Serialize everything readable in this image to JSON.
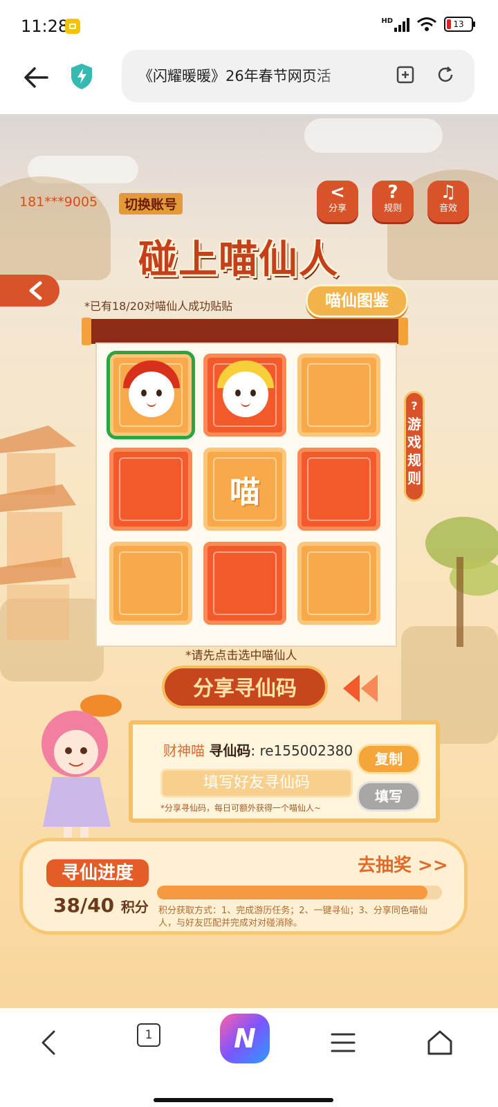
{
  "status_bar": {
    "time": "11:28",
    "network": "HD",
    "battery": "13"
  },
  "browser": {
    "url_title": "《闪耀暖暖》26年春节网页活"
  },
  "header": {
    "phone": "181***9005",
    "switch_account": "切换账号",
    "buttons": [
      {
        "label": "分享",
        "glyph": "<"
      },
      {
        "label": "规则",
        "glyph": "?"
      },
      {
        "label": "音效",
        "glyph": "♫"
      }
    ]
  },
  "game": {
    "title": "碰上喵仙人",
    "paired_note": "*已有18/20对喵仙人成功贴贴",
    "atlas_button": "喵仙图鉴",
    "center_tile": "喵",
    "rules_tab": "游戏规则",
    "rules_icon": "?",
    "select_hint": "*请先点击选中喵仙人",
    "share_code_button": "分享寻仙码"
  },
  "code_panel": {
    "cat_name": "财神喵",
    "code_label": "寻仙码",
    "code_value": "re155002380",
    "input_placeholder": "填写好友寻仙码",
    "copy_button": "复制",
    "fill_button": "填写",
    "tip": "*分享寻仙码，每日可额外获得一个喵仙人~"
  },
  "progress": {
    "label": "寻仙进度",
    "current": "38",
    "separator": "/",
    "total": "40",
    "unit": "积分",
    "fraction": 0.95,
    "draw_link": "去抽奖 >>",
    "method_text": "积分获取方式：1、完成游历任务；2、一键寻仙；3、分享同色喵仙人，与好友匹配并完成对对碰消除。"
  },
  "bottom_nav": {
    "tab_count": "1",
    "app_letter": "N"
  },
  "colors": {
    "accent": "#d9532a",
    "tile_light": "#f8a94a",
    "tile_dark": "#f25a2c",
    "selected": "#2aa542"
  }
}
